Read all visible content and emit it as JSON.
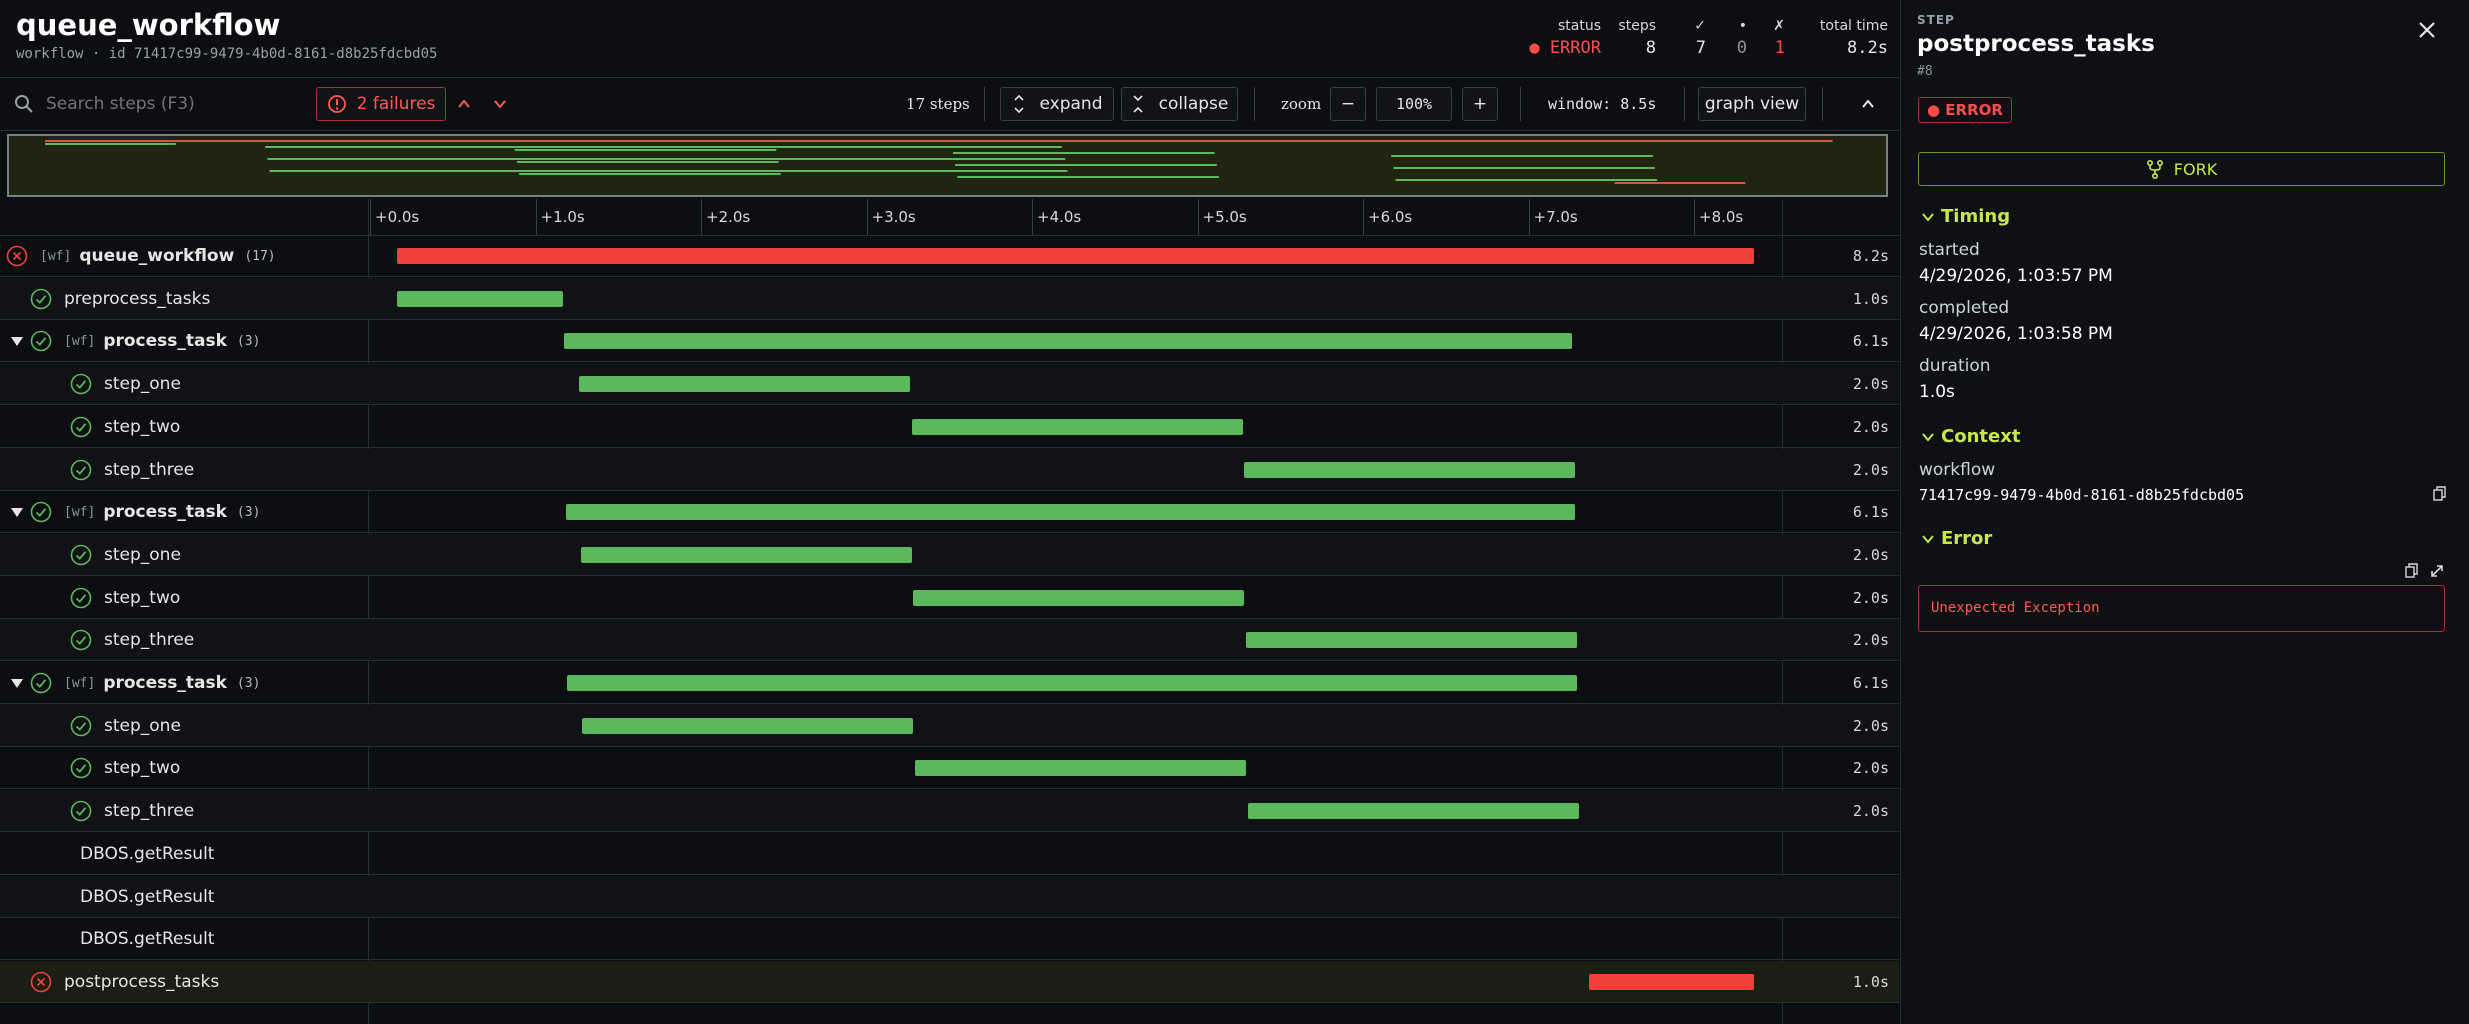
{
  "header": {
    "title": "queue_workflow",
    "subtitle": "workflow · id 71417c99-9479-4b0d-8161-d8b25fdcbd05",
    "stats": [
      {
        "label": "status",
        "value": "● ERROR",
        "color": "#ff4d4d"
      },
      {
        "label": "steps",
        "value": "8",
        "color": "#e6e6e6"
      },
      {
        "label": "✓",
        "value": "7",
        "color": "#e6e6e6"
      },
      {
        "label": "•",
        "value": "0",
        "color": "#8d939b"
      },
      {
        "label": "✗",
        "value": "1",
        "color": "#ff4d4d"
      },
      {
        "label": "total time",
        "value": "8.2s",
        "color": "#e6e6e6"
      }
    ]
  },
  "toolbar": {
    "search_placeholder": "Search steps (F3)",
    "failures_label": "2 failures",
    "steps_count": "17 steps",
    "expand_label": "expand",
    "collapse_label": "collapse",
    "zoom_label": "zoom",
    "zoom_minus": "−",
    "zoom_value": "100%",
    "zoom_plus": "+",
    "window_label": "window: 8.5s",
    "graph_view_label": "graph view"
  },
  "axis": {
    "ticks": [
      "+0.0s",
      "+1.0s",
      "+2.0s",
      "+3.0s",
      "+4.0s",
      "+5.0s",
      "+6.0s",
      "+7.0s",
      "+8.0s"
    ],
    "window_seconds": 8.5
  },
  "rows": [
    {
      "name": "queue_workflow",
      "wf": "[wf]",
      "count": "(17)",
      "status": "error",
      "indent": 0,
      "caret": true,
      "bold": true,
      "start": 0.0,
      "end": 8.2,
      "duration": "8.2s"
    },
    {
      "name": "preprocess_tasks",
      "status": "ok",
      "indent": 1,
      "start": 0.0,
      "end": 1.0,
      "duration": "1.0s"
    },
    {
      "name": "process_task",
      "wf": "[wf]",
      "count": "(3)",
      "status": "ok",
      "indent": 1,
      "caret": true,
      "bold": true,
      "start": 1.01,
      "end": 7.1,
      "duration": "6.1s"
    },
    {
      "name": "step_one",
      "status": "ok",
      "indent": 2,
      "start": 1.1,
      "end": 3.1,
      "duration": "2.0s"
    },
    {
      "name": "step_two",
      "status": "ok",
      "indent": 2,
      "start": 3.11,
      "end": 5.11,
      "duration": "2.0s"
    },
    {
      "name": "step_three",
      "status": "ok",
      "indent": 2,
      "start": 5.12,
      "end": 7.12,
      "duration": "2.0s"
    },
    {
      "name": "process_task",
      "wf": "[wf]",
      "count": "(3)",
      "status": "ok",
      "indent": 1,
      "caret": true,
      "bold": true,
      "start": 1.02,
      "end": 7.12,
      "duration": "6.1s"
    },
    {
      "name": "step_one",
      "status": "ok",
      "indent": 2,
      "start": 1.11,
      "end": 3.11,
      "duration": "2.0s"
    },
    {
      "name": "step_two",
      "status": "ok",
      "indent": 2,
      "start": 3.12,
      "end": 5.12,
      "duration": "2.0s"
    },
    {
      "name": "step_three",
      "status": "ok",
      "indent": 2,
      "start": 5.13,
      "end": 7.13,
      "duration": "2.0s"
    },
    {
      "name": "process_task",
      "wf": "[wf]",
      "count": "(3)",
      "status": "ok",
      "indent": 1,
      "caret": true,
      "bold": true,
      "start": 1.03,
      "end": 7.13,
      "duration": "6.1s"
    },
    {
      "name": "step_one",
      "status": "ok",
      "indent": 2,
      "start": 1.12,
      "end": 3.12,
      "duration": "2.0s"
    },
    {
      "name": "step_two",
      "status": "ok",
      "indent": 2,
      "start": 3.13,
      "end": 5.13,
      "duration": "2.0s"
    },
    {
      "name": "step_three",
      "status": "ok",
      "indent": 2,
      "start": 5.14,
      "end": 7.14,
      "duration": "2.0s"
    },
    {
      "name": "DBOS.getResult",
      "status": "none",
      "indent": 1
    },
    {
      "name": "DBOS.getResult",
      "status": "none",
      "indent": 1
    },
    {
      "name": "DBOS.getResult",
      "status": "none",
      "indent": 1
    },
    {
      "name": "postprocess_tasks",
      "status": "error",
      "indent": 1,
      "selected": true,
      "start": 7.2,
      "end": 8.2,
      "duration": "1.0s"
    }
  ],
  "detail": {
    "kicker": "STEP",
    "title": "postprocess_tasks",
    "step_no": "#8",
    "status_badge": "● ERROR",
    "fork_label": "FORK",
    "timing_header": "Timing",
    "started_label": "started",
    "started_value": "4/29/2026, 1:03:57 PM",
    "completed_label": "completed",
    "completed_value": "4/29/2026, 1:03:58 PM",
    "duration_label": "duration",
    "duration_value": "1.0s",
    "context_header": "Context",
    "workflow_label": "workflow",
    "workflow_value": "71417c99-9479-4b0d-8161-d8b25fdcbd05",
    "error_header": "Error",
    "error_message": "Unexpected Exception"
  },
  "colors": {
    "ok": "#5cb85c",
    "error": "#f0403c",
    "accent": "#c7e84c"
  }
}
